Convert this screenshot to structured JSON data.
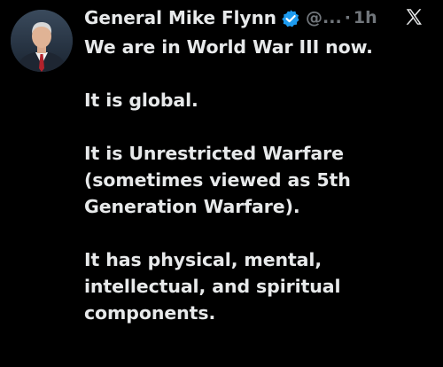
{
  "post": {
    "author_name": "General Mike Flynn",
    "handle": "@...",
    "separator": "·",
    "time": "1h",
    "verified": true,
    "paragraphs": [
      "We are in World War III now.",
      "It is global.",
      "It is Unrestricted Warfare (sometimes viewed as 5th Generation Warfare).",
      "It has physical, mental, intellectual, and spiritual components."
    ]
  },
  "icons": {
    "avatar": "profile-photo",
    "verified": "verified-badge-icon",
    "logo": "x-logo-icon"
  },
  "colors": {
    "background": "#000000",
    "text": "#e7e9ea",
    "secondary": "#71767b",
    "verified": "#1d9bf0"
  }
}
